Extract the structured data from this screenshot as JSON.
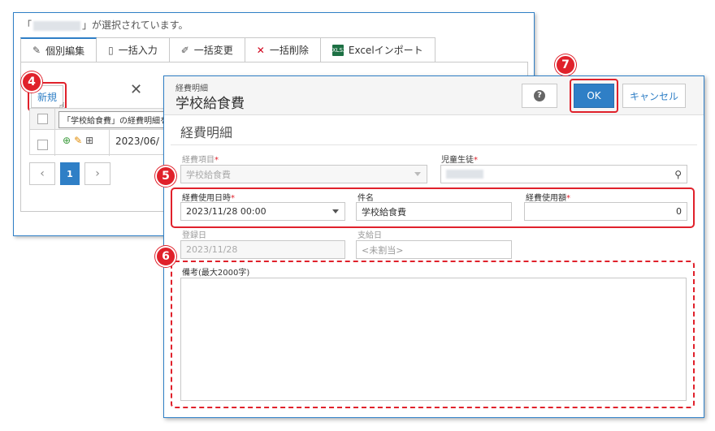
{
  "background": {
    "notice_prefix": "「",
    "notice_suffix": "」が選択されています。",
    "tabs": [
      {
        "label": "個別編集",
        "icon": "edit-icon"
      },
      {
        "label": "一括入力",
        "icon": "document-icon"
      },
      {
        "label": "一括変更",
        "icon": "pencil-icon"
      },
      {
        "label": "一括削除",
        "icon": "delete-x-icon"
      },
      {
        "label": "Excelインポート",
        "icon": "excel-icon"
      }
    ],
    "new_button": "新規",
    "tooltip": "「学校給食費」の経費明細を作",
    "row_date": "2023/06/",
    "pager": {
      "prev": "‹",
      "current": "1",
      "next": "›"
    }
  },
  "badges": {
    "b4": "4",
    "b5": "5",
    "b6": "6",
    "b7": "7"
  },
  "dialog": {
    "subtitle": "経費明細",
    "title": "学校給食費",
    "help_icon": "?",
    "ok": "OK",
    "cancel": "キャンセル",
    "section": "経費明細",
    "fields": {
      "expense_item": {
        "label": "経費項目",
        "value": "学校給食費"
      },
      "student": {
        "label": "児童生徒"
      },
      "use_datetime": {
        "label": "経費使用日時",
        "value": "2023/11/28 00:00"
      },
      "subject": {
        "label": "件名",
        "value": "学校給食費"
      },
      "amount": {
        "label": "経費使用額",
        "value": "0"
      },
      "registered": {
        "label": "登録日",
        "value": "2023/11/28"
      },
      "payment": {
        "label": "支給日",
        "placeholder": "<未割当>"
      },
      "memo": {
        "label": "備考(最大2000字)"
      }
    },
    "required_mark": "*"
  }
}
